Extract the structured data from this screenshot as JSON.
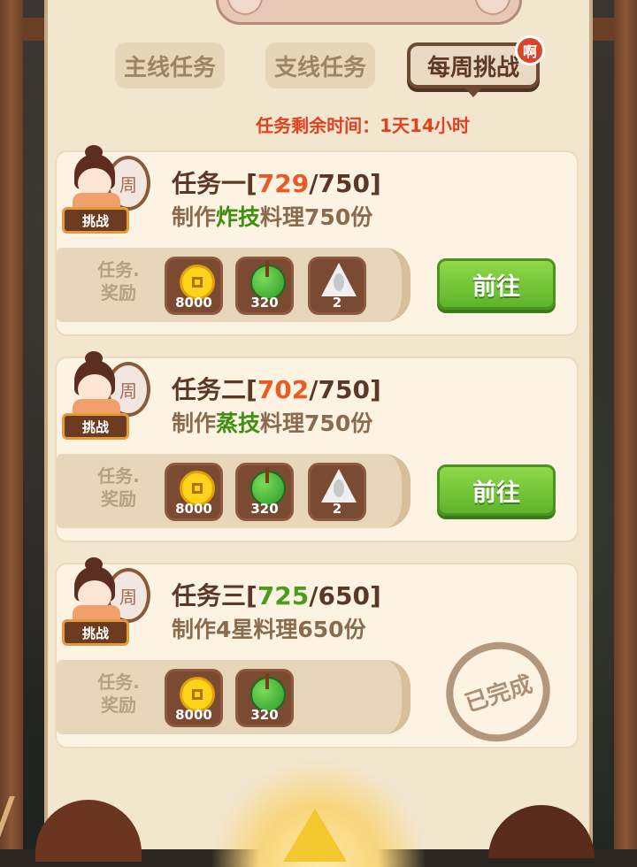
{
  "tabs": [
    {
      "label": "主线任务",
      "active": false
    },
    {
      "label": "支线任务",
      "active": false
    },
    {
      "label": "每周挑战",
      "active": true,
      "badge": "啊"
    }
  ],
  "time_remaining": "任务剩余时间：1天14小时",
  "avatar": {
    "drum_char": "周",
    "tag": "挑战"
  },
  "reward_label": "任务.奖励",
  "tasks": [
    {
      "title_prefix": "任务一[",
      "progress_current": "729",
      "progress_sep": "/750]",
      "desc_prefix": "制作",
      "desc_highlight": "炸技",
      "desc_suffix": "料理750份",
      "rewards": [
        {
          "icon": "gold-coin-icon",
          "count": "8000"
        },
        {
          "icon": "jade-orb-icon",
          "count": "320"
        },
        {
          "icon": "rice-dumpling-icon",
          "count": "2"
        }
      ],
      "button": "前往",
      "status": "in-progress"
    },
    {
      "title_prefix": "任务二[",
      "progress_current": "702",
      "progress_sep": "/750]",
      "desc_prefix": "制作",
      "desc_highlight": "蒸技",
      "desc_suffix": "料理750份",
      "rewards": [
        {
          "icon": "gold-coin-icon",
          "count": "8000"
        },
        {
          "icon": "jade-orb-icon",
          "count": "320"
        },
        {
          "icon": "rice-dumpling-icon",
          "count": "2"
        }
      ],
      "button": "前往",
      "status": "in-progress"
    },
    {
      "title_prefix": "任务三[",
      "progress_current": "725",
      "progress_sep": "/650]",
      "desc_prefix": "制作4星料理650份",
      "desc_highlight": "",
      "desc_suffix": "",
      "rewards": [
        {
          "icon": "gold-coin-icon",
          "count": "8000"
        },
        {
          "icon": "jade-orb-icon",
          "count": "320"
        }
      ],
      "stamp": "已完成",
      "status": "completed"
    }
  ],
  "colors": {
    "progress_incomplete": "#ea5a25",
    "progress_complete": "#4b9b1f",
    "time_text": "#e0411f",
    "go_button": "#6fc235"
  }
}
